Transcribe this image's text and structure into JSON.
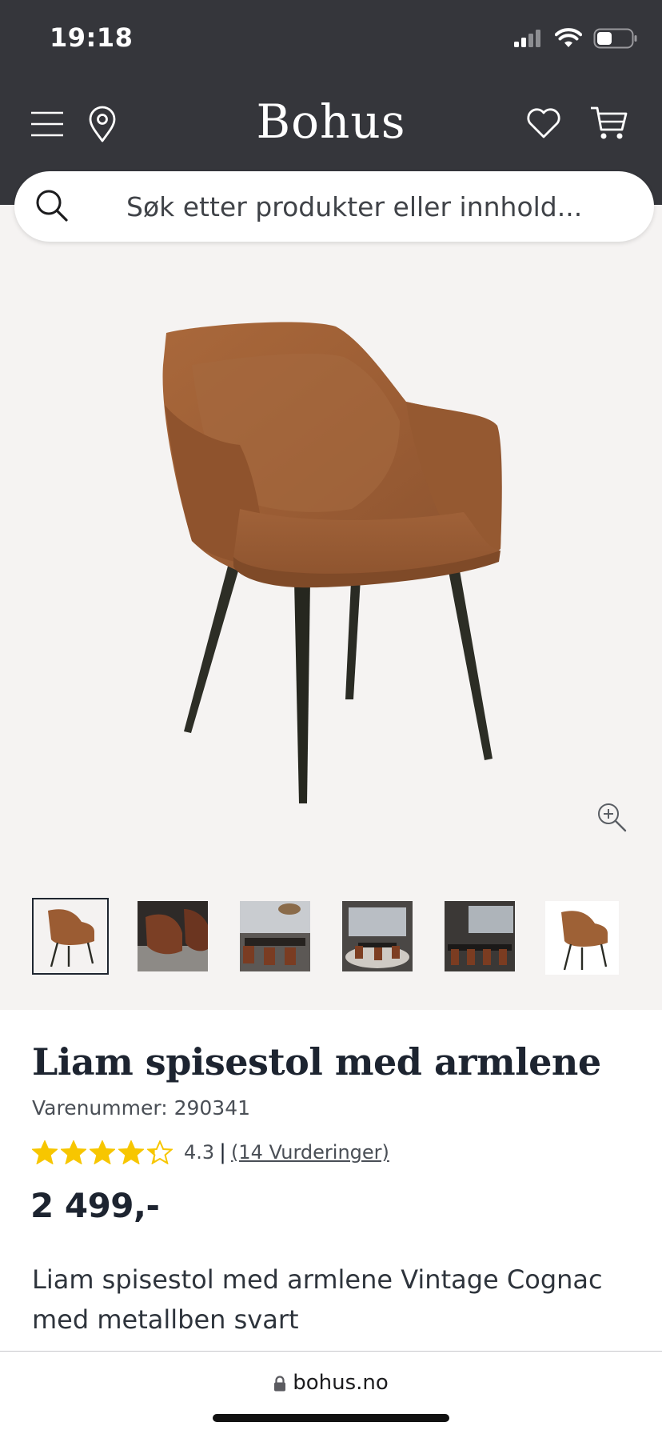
{
  "status_bar": {
    "time": "19:18"
  },
  "header": {
    "logo": "Bohus"
  },
  "search": {
    "placeholder": "Søk etter produkter eller innhold..."
  },
  "product": {
    "title": "Liam spisestol med armlene",
    "sku_label": "Varenummer: 290341",
    "rating_value": "4.3",
    "rating_fraction": 0.86,
    "separator": "|",
    "reviews_link": "(14 Vurderinger)",
    "price": "2 499,-",
    "description": "Liam spisestol med armlene Vintage Cognac med metallben svart"
  },
  "gallery": {
    "thumbnail_count": 6,
    "active_index": 0
  },
  "browser": {
    "url": "bohus.no"
  },
  "colors": {
    "header_bg": "#35363b",
    "gallery_bg": "#f5f3f2",
    "star": "#f7c600",
    "leather": "#9a5a30",
    "text_dark": "#1d2430"
  },
  "icons": {
    "menu": "hamburger-icon",
    "location": "location-pin-icon",
    "wishlist": "heart-icon",
    "cart": "cart-icon",
    "search": "search-icon",
    "zoom": "zoom-in-icon",
    "lock": "lock-icon"
  }
}
